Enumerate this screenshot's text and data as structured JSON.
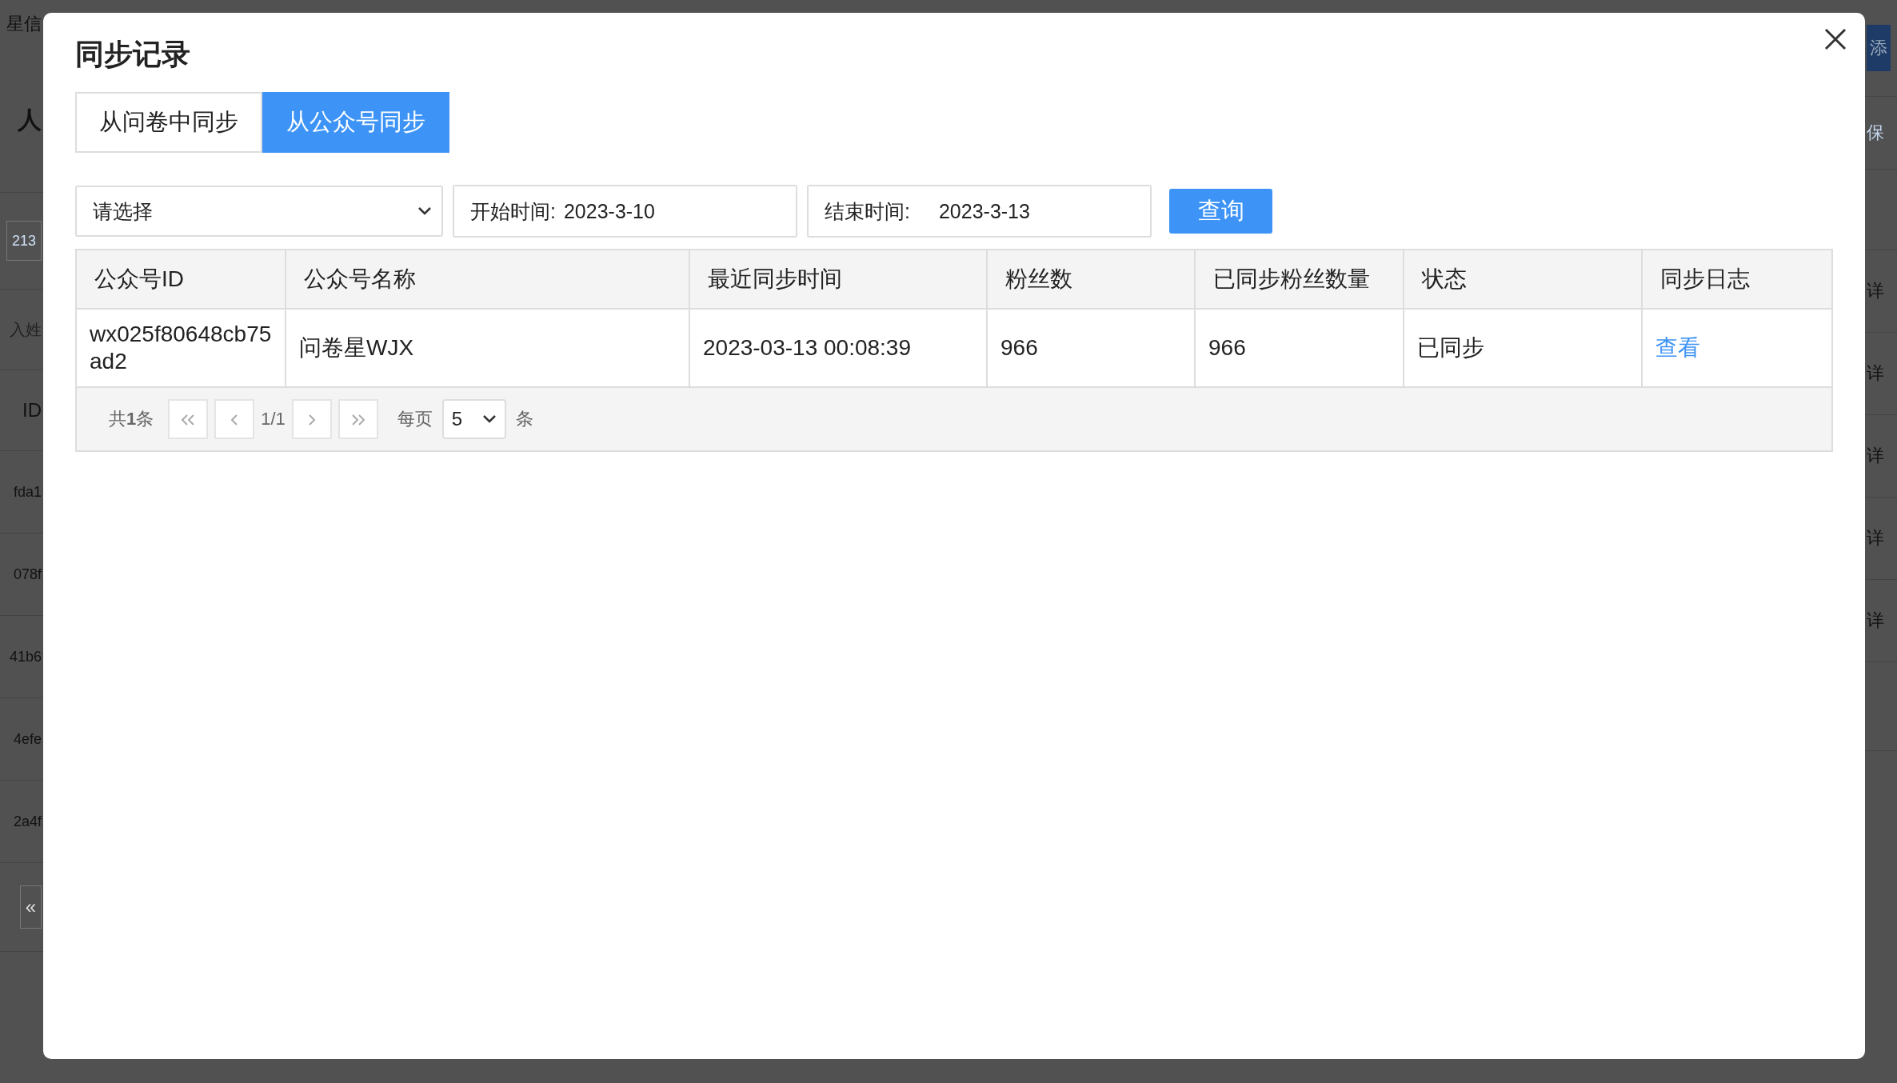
{
  "backdrop": {
    "left": [
      {
        "kind": "brand",
        "text": "星信"
      },
      {
        "kind": "heading",
        "text": "人"
      },
      {
        "kind": "input",
        "text": "213"
      },
      {
        "kind": "hint",
        "text": "入姓"
      },
      {
        "kind": "head",
        "text": "ID"
      },
      {
        "kind": "cell",
        "text": "fda1"
      },
      {
        "kind": "cell",
        "text": "078f"
      },
      {
        "kind": "cell",
        "text": "41b6"
      },
      {
        "kind": "cell",
        "text": "4efe"
      },
      {
        "kind": "cell",
        "text": "2a4f"
      },
      {
        "kind": "pager",
        "text": "«"
      }
    ],
    "right": [
      {
        "kind": "button",
        "text": "添"
      },
      {
        "kind": "link",
        "text": "保"
      },
      {
        "kind": "head"
      },
      {
        "kind": "cell",
        "text": "详"
      },
      {
        "kind": "cell",
        "text": "详"
      },
      {
        "kind": "cell",
        "text": "详"
      },
      {
        "kind": "cell",
        "text": "详"
      },
      {
        "kind": "cell",
        "text": "详"
      },
      {
        "kind": "pager"
      }
    ]
  },
  "dialog": {
    "title": "同步记录",
    "tabs": [
      {
        "label": "从问卷中同步",
        "selected": false
      },
      {
        "label": "从公众号同步",
        "selected": true
      }
    ],
    "filters": {
      "select": {
        "value": "请选择"
      },
      "start": {
        "label": "开始时间:",
        "value": "2023-3-10"
      },
      "end": {
        "label": "结束时间:",
        "value": "2023-3-13"
      },
      "button": "查询"
    },
    "table": {
      "columns": [
        "公众号ID",
        "公众号名称",
        "最近同步时间",
        "粉丝数",
        "已同步粉丝数量",
        "状态",
        "同步日志"
      ],
      "rows": [
        {
          "cells": [
            "wx025f80648cb75ad2",
            "问卷星WJX",
            "2023-03-13 00:08:39",
            "966",
            "966",
            "已同步"
          ],
          "link": "查看"
        }
      ]
    },
    "pagination": {
      "total": "共**1**条",
      "page": "1/1",
      "per_page_label": "每页",
      "per_page": "5",
      "unit": "条"
    }
  }
}
